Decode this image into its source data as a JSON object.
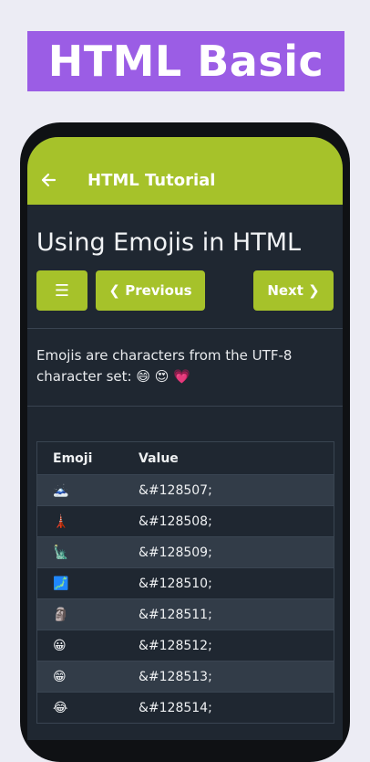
{
  "banner": {
    "title": "HTML Basic"
  },
  "appbar": {
    "title": "HTML Tutorial"
  },
  "page": {
    "title": "Using Emojis in HTML"
  },
  "buttons": {
    "menu": "☰",
    "previous": "❮ Previous",
    "next": "Next ❯"
  },
  "intro": "Emojis are characters from the UTF-8 character set: 😄 😍 💗",
  "table": {
    "headers": [
      "Emoji",
      "Value"
    ],
    "rows": [
      {
        "emoji": "🗻",
        "value": "&#128507;"
      },
      {
        "emoji": "🗼",
        "value": "&#128508;"
      },
      {
        "emoji": "🗽",
        "value": "&#128509;"
      },
      {
        "emoji": "🗾",
        "value": "&#128510;"
      },
      {
        "emoji": "🗿",
        "value": "&#128511;"
      },
      {
        "emoji": "😀",
        "value": "&#128512;"
      },
      {
        "emoji": "😁",
        "value": "&#128513;"
      },
      {
        "emoji": "😂",
        "value": "&#128514;"
      }
    ]
  },
  "colors": {
    "accent": "#a6c22a",
    "banner": "#9b5de5",
    "background": "#1f2731",
    "row_alt": "#323c48"
  }
}
